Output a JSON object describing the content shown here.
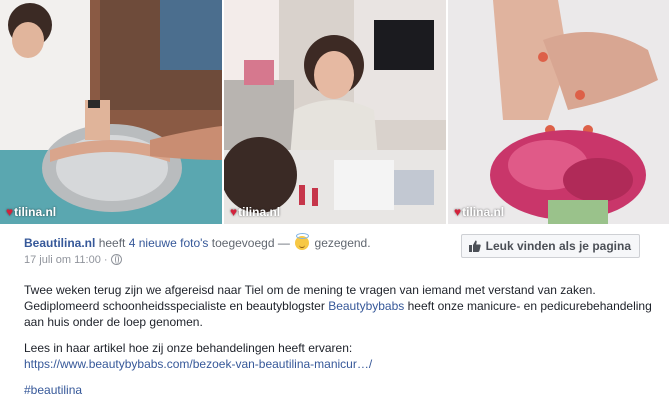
{
  "photos": [
    {
      "watermark": "tilina.nl",
      "icon": "heart-logo-icon"
    },
    {
      "watermark": "tilina.nl",
      "icon": "heart-logo-icon"
    },
    {
      "watermark": "tilina.nl",
      "icon": "heart-logo-icon"
    }
  ],
  "post": {
    "page_name": "Beautilina.nl",
    "action_text": "heeft",
    "photos_link": "4 nieuwe foto's",
    "action_suffix": "toegevoegd —",
    "feeling": "gezegend.",
    "feeling_icon": "blessed-emoji-icon",
    "date": "17 juli om 11:00 ·",
    "privacy_icon": "globe-icon",
    "like_button": "Leuk vinden als je pagina",
    "paragraph1_a": "Twee weken terug zijn we afgereisd naar Tiel om de mening te vragen van iemand met verstand van zaken. Gediplomeerd schoonheidsspecialiste en beautyblogster ",
    "paragraph1_link": "Beautybybabs",
    "paragraph1_b": " heeft onze manicure- en pedicurebehandeling aan huis onder de loep genomen.",
    "paragraph2": "Lees in haar artikel hoe zij onze behandelingen heeft ervaren:",
    "url": "https://www.beautybybabs.com/bezoek-van-beautilina-manicur…/",
    "hashtag": "#beautilina"
  },
  "colors": {
    "link": "#365899",
    "meta": "#90949c",
    "watermark_heart": "#d3223c"
  }
}
